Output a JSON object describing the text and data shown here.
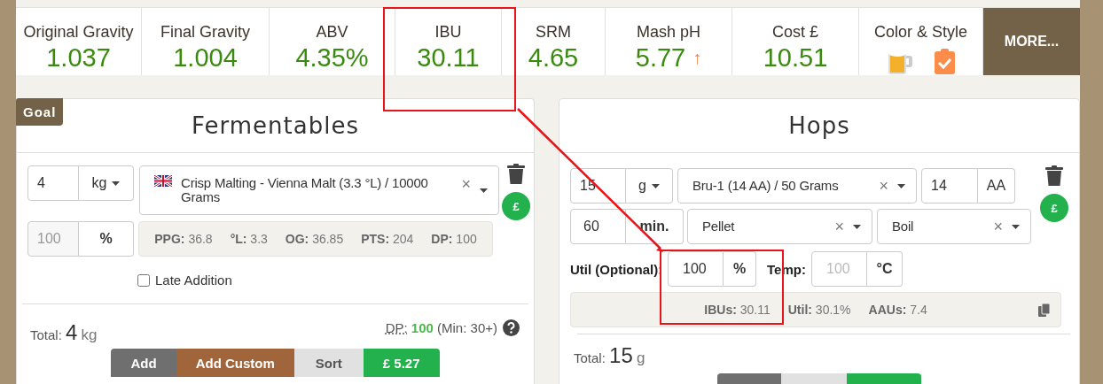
{
  "stats": [
    {
      "kind": "number",
      "label": "Original Gravity",
      "value": "1.037"
    },
    {
      "kind": "number",
      "label": "Final Gravity",
      "value": "1.004"
    },
    {
      "kind": "number",
      "label": "ABV",
      "value": "4.35%"
    },
    {
      "kind": "number",
      "label": "IBU",
      "value": "30.11"
    },
    {
      "kind": "number",
      "label": "SRM",
      "value": "4.65"
    },
    {
      "kind": "number",
      "label": "Mash pH",
      "value": "5.77",
      "trend": "↑"
    },
    {
      "kind": "number",
      "label": "Cost £",
      "value": "10.51"
    },
    {
      "kind": "icons",
      "label": "Color & Style"
    }
  ],
  "more_button": "MORE...",
  "fermentables": {
    "badge": "Goal",
    "title": "Fermentables",
    "amount": "4",
    "unit": "kg",
    "ingredient": "Crisp Malting - Vienna Malt (3.3 °L) / 10000 Grams",
    "clear": "×",
    "percent": "100",
    "percent_unit": "%",
    "info": [
      {
        "label": "PPG:",
        "value": "36.8"
      },
      {
        "label": "°L:",
        "value": "3.3"
      },
      {
        "label": "OG:",
        "value": "36.85"
      },
      {
        "label": "PTS:",
        "value": "204"
      },
      {
        "label": "DP:",
        "value": "100"
      }
    ],
    "price_badge": "£",
    "late_addition": {
      "label": "Late Addition",
      "checked": false
    },
    "total": {
      "label": "Total:",
      "value": "4",
      "unit": "kg"
    },
    "dp": {
      "label": "DP:",
      "value": "100",
      "note": "(Min: 30+)"
    },
    "buttons": [
      {
        "label": "Add",
        "color": "#6f6f6f"
      },
      {
        "label": "Add Custom",
        "color": "#a0653b"
      },
      {
        "label": "Sort",
        "color": "#e1e1e1"
      },
      {
        "label": "£ 5.27",
        "color": "#22b14c"
      }
    ]
  },
  "hops": {
    "title": "Hops",
    "amount": "15",
    "unit": "g",
    "variety": "Bru-1 (14 AA) / 50 Grams",
    "aa": "14",
    "aa_unit": "AA",
    "time": "60",
    "time_unit": "min.",
    "form": "Pellet",
    "use": "Boil",
    "clear": "×",
    "price_badge": "£",
    "util_label": "Util (Optional):",
    "util": "100",
    "util_unit": "%",
    "temp_label": "Temp:",
    "temp_placeholder": "100",
    "temp_unit": "°C",
    "info": [
      {
        "label": "IBUs:",
        "value": "30.11"
      },
      {
        "label": "Util:",
        "value": "30.1%"
      },
      {
        "label": "AAUs:",
        "value": "7.4"
      }
    ],
    "total": {
      "label": "Total:",
      "value": "15",
      "unit": "g"
    },
    "buttons": [
      {
        "color": "#6f6f6f"
      },
      {
        "color": "#e1e1e1"
      },
      {
        "color": "#22b14c"
      }
    ]
  }
}
